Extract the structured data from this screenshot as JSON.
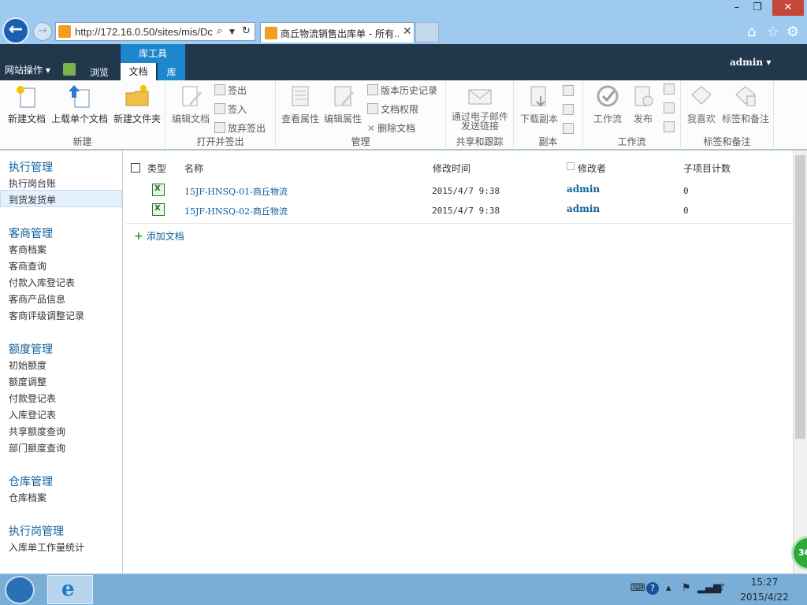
{
  "window": {
    "minimize": "–",
    "maximize": "❐",
    "close": "✕"
  },
  "browser": {
    "address": "http://172.16.0.50/sites/mis/Dc",
    "tab_title": "商丘物流销售出库单 - 所有...",
    "tab_close": "✕",
    "icons": [
      "home-icon",
      "star-icon",
      "gear-icon"
    ]
  },
  "ribbon": {
    "tools_label": "库工具",
    "site_actions": "网站操作 ▾",
    "tabs": {
      "browse": "浏览",
      "document": "文档",
      "library": "库"
    },
    "user": "admin ▾",
    "groups": {
      "new": {
        "label": "新建",
        "new_doc": "新建文档",
        "upload": "上载单个文档",
        "new_folder": "新建文件夹"
      },
      "open": {
        "label": "打开并签出",
        "edit_doc": "编辑文档",
        "check_out": "签出",
        "check_in": "签入",
        "discard": "放弃签出"
      },
      "manage": {
        "label": "管理",
        "view_props": "查看属性",
        "edit_props": "编辑属性",
        "version_history": "版本历史记录",
        "permissions": "文档权限",
        "delete": "删除文档"
      },
      "share": {
        "label": "共享和跟踪",
        "email_line1": "通过电子邮件",
        "email_line2": "发送链接"
      },
      "copies": {
        "label": "副本",
        "download": "下载副本"
      },
      "workflow": {
        "label": "工作流",
        "workflows": "工作流",
        "publish": "发布"
      },
      "tags": {
        "label": "标签和备注",
        "like": "我喜欢",
        "tags_notes": "标签和备注"
      }
    }
  },
  "sidebar": {
    "sections": [
      {
        "heading": "执行管理",
        "items": [
          "执行岗台账",
          "到货发货单"
        ]
      },
      {
        "heading": "客商管理",
        "items": [
          "客商档案",
          "客商查询",
          "付款入库登记表",
          "客商产品信息",
          "客商评级调整记录"
        ]
      },
      {
        "heading": "额度管理",
        "items": [
          "初始额度",
          "额度调整",
          "付款登记表",
          "入库登记表",
          "共享额度查询",
          "部门额度查询"
        ]
      },
      {
        "heading": "仓库管理",
        "items": [
          "仓库档案"
        ]
      },
      {
        "heading": "执行岗管理",
        "items": [
          "入库单工作量统计"
        ]
      }
    ],
    "selected": "到货发货单"
  },
  "list": {
    "columns": {
      "type": "类型",
      "name": "名称",
      "modified": "修改时间",
      "modified_by": "修改者",
      "child_count": "子项目计数"
    },
    "rows": [
      {
        "name": "15JF-HNSQ-01-商丘物流",
        "modified": "2015/4/7 9:38",
        "modified_by": "admin",
        "child_count": "0"
      },
      {
        "name": "15JF-HNSQ-02-商丘物流",
        "modified": "2015/4/7 9:38",
        "modified_by": "admin",
        "child_count": "0"
      }
    ],
    "add_document": "添加文档",
    "add_icon": "+"
  },
  "badge": "36",
  "taskbar": {
    "ie_icon": "e",
    "tray": [
      "keyboard-icon",
      "help-icon",
      "network-icon",
      "volume-icon"
    ],
    "help_glyph": "?",
    "time": "15:27",
    "date": "2015/4/22"
  }
}
